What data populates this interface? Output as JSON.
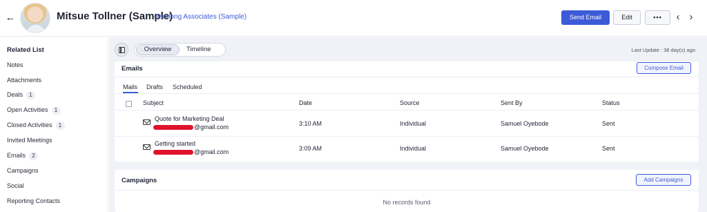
{
  "header": {
    "record_name": "Mitsue Tollner (Sample)",
    "separator": "-",
    "account_name": "Morlong Associates (Sample)",
    "send_email_label": "Send Email",
    "edit_label": "Edit",
    "more_label": "•••",
    "back_icon": "←",
    "prev_icon": "‹",
    "next_icon": "›"
  },
  "sidebar": {
    "title": "Related List",
    "items": [
      {
        "label": "Notes",
        "badge": ""
      },
      {
        "label": "Attachments",
        "badge": ""
      },
      {
        "label": "Deals",
        "badge": "1"
      },
      {
        "label": "Open Activities",
        "badge": "1"
      },
      {
        "label": "Closed Activities",
        "badge": "1"
      },
      {
        "label": "Invited Meetings",
        "badge": ""
      },
      {
        "label": "Emails",
        "badge": "2"
      },
      {
        "label": "Campaigns",
        "badge": ""
      },
      {
        "label": "Social",
        "badge": ""
      },
      {
        "label": "Reporting Contacts",
        "badge": ""
      }
    ]
  },
  "view_tabs": {
    "overview": "Overview",
    "timeline": "Timeline"
  },
  "last_update": "Last Update : 38 day(s) ago",
  "emails": {
    "title": "Emails",
    "compose_label": "Compose Email",
    "tabs": [
      "Mails",
      "Drafts",
      "Scheduled"
    ],
    "columns": [
      "Subject",
      "Date",
      "Source",
      "Sent By",
      "Status"
    ],
    "rows": [
      {
        "subject": "Quote for Marketing Deal",
        "email_suffix": "@gmail.com",
        "date": "3:10 AM",
        "source": "Individual",
        "sent_by": "Samuel Oyebode",
        "status": "Sent"
      },
      {
        "subject": "Getting started",
        "email_suffix": "@gmail.com",
        "date": "3:09 AM",
        "source": "Individual",
        "sent_by": "Samuel Oyebode",
        "status": "Sent"
      }
    ]
  },
  "campaigns": {
    "title": "Campaigns",
    "add_label": "Add Campaigns",
    "empty_text": "No records found"
  },
  "colors": {
    "accent": "#3d5bd6",
    "redaction": "#e0142c",
    "background": "#f0f2f7"
  }
}
